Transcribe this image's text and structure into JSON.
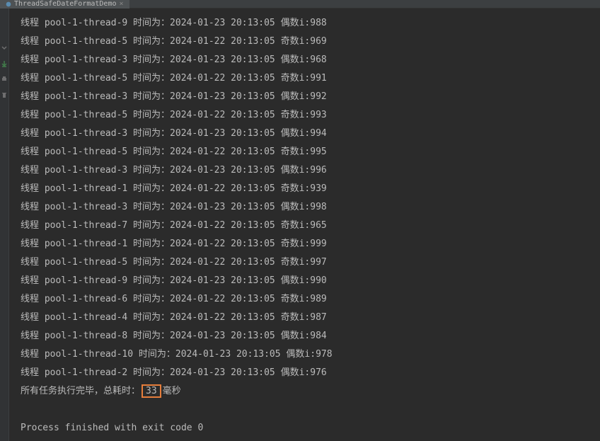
{
  "tab": {
    "name": "ThreadSafeDateFormatDemo"
  },
  "logs": [
    {
      "thread": "pool-1-thread-9",
      "date": "2024-01-23 20:13:05",
      "type": "偶数",
      "i": "988"
    },
    {
      "thread": "pool-1-thread-5",
      "date": "2024-01-22 20:13:05",
      "type": "奇数",
      "i": "969"
    },
    {
      "thread": "pool-1-thread-3",
      "date": "2024-01-23 20:13:05",
      "type": "偶数",
      "i": "968"
    },
    {
      "thread": "pool-1-thread-5",
      "date": "2024-01-22 20:13:05",
      "type": "奇数",
      "i": "991"
    },
    {
      "thread": "pool-1-thread-3",
      "date": "2024-01-23 20:13:05",
      "type": "偶数",
      "i": "992"
    },
    {
      "thread": "pool-1-thread-5",
      "date": "2024-01-22 20:13:05",
      "type": "奇数",
      "i": "993"
    },
    {
      "thread": "pool-1-thread-3",
      "date": "2024-01-23 20:13:05",
      "type": "偶数",
      "i": "994"
    },
    {
      "thread": "pool-1-thread-5",
      "date": "2024-01-22 20:13:05",
      "type": "奇数",
      "i": "995"
    },
    {
      "thread": "pool-1-thread-3",
      "date": "2024-01-23 20:13:05",
      "type": "偶数",
      "i": "996"
    },
    {
      "thread": "pool-1-thread-1",
      "date": "2024-01-22 20:13:05",
      "type": "奇数",
      "i": "939"
    },
    {
      "thread": "pool-1-thread-3",
      "date": "2024-01-23 20:13:05",
      "type": "偶数",
      "i": "998"
    },
    {
      "thread": "pool-1-thread-7",
      "date": "2024-01-22 20:13:05",
      "type": "奇数",
      "i": "965"
    },
    {
      "thread": "pool-1-thread-1",
      "date": "2024-01-22 20:13:05",
      "type": "奇数",
      "i": "999"
    },
    {
      "thread": "pool-1-thread-5",
      "date": "2024-01-22 20:13:05",
      "type": "奇数",
      "i": "997"
    },
    {
      "thread": "pool-1-thread-9",
      "date": "2024-01-23 20:13:05",
      "type": "偶数",
      "i": "990"
    },
    {
      "thread": "pool-1-thread-6",
      "date": "2024-01-22 20:13:05",
      "type": "奇数",
      "i": "989"
    },
    {
      "thread": "pool-1-thread-4",
      "date": "2024-01-22 20:13:05",
      "type": "奇数",
      "i": "987"
    },
    {
      "thread": "pool-1-thread-8",
      "date": "2024-01-23 20:13:05",
      "type": "偶数",
      "i": "984"
    },
    {
      "thread": "pool-1-thread-10",
      "date": "2024-01-23 20:13:05",
      "type": "偶数",
      "i": "978"
    },
    {
      "thread": "pool-1-thread-2",
      "date": "2024-01-23 20:13:05",
      "type": "偶数",
      "i": "976"
    }
  ],
  "summary": {
    "prefix": "所有任务执行完毕，总耗时：",
    "value": "33",
    "suffix": "毫秒"
  },
  "exit": "Process finished with exit code 0",
  "labels": {
    "thread_prefix": "线程 ",
    "time_label": " 时间为：",
    "i_label": "i:"
  }
}
